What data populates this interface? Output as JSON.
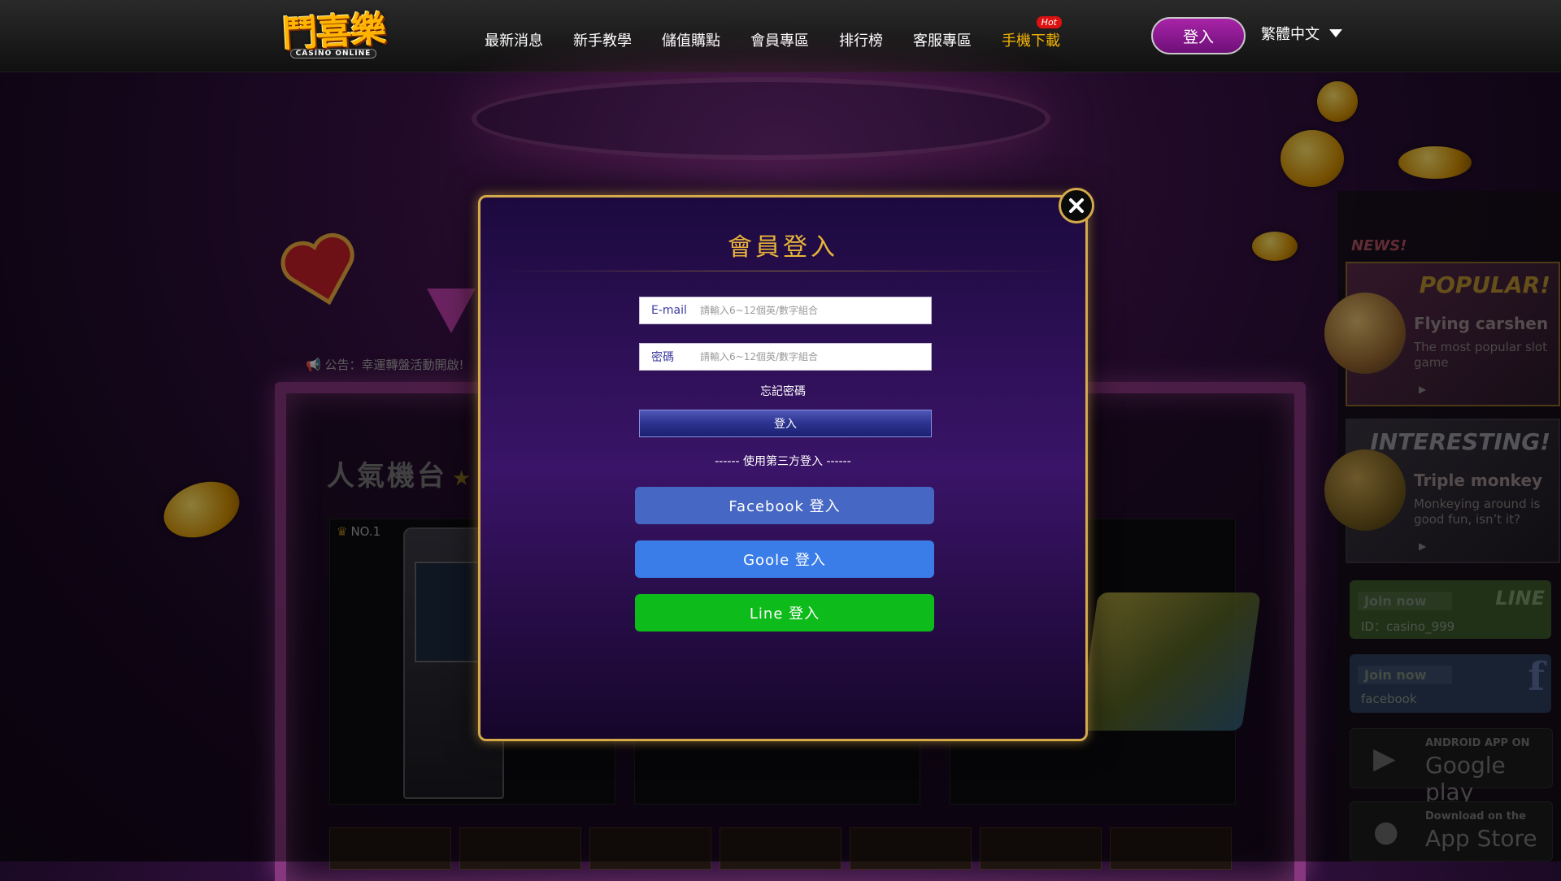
{
  "header": {
    "logo_text": "鬥喜樂",
    "logo_sub": "CASINO ONLINE",
    "nav": [
      {
        "label": "最新消息"
      },
      {
        "label": "新手教學"
      },
      {
        "label": "儲值購點"
      },
      {
        "label": "會員專區"
      },
      {
        "label": "排行榜"
      },
      {
        "label": "客服專區"
      },
      {
        "label": "手機下載",
        "badge": "Hot"
      }
    ],
    "login_label": "登入",
    "language": "繁體中文"
  },
  "background": {
    "notice": "公告：幸運轉盤活動開啟!",
    "section_title": "人氣機台",
    "rank_label": "NO.1",
    "sidebar": {
      "news_label": "NEWS!",
      "promos": [
        {
          "head": "POPULAR!",
          "title": "Flying carshen",
          "desc": "The most popular slot game"
        },
        {
          "head": "INTERESTING!",
          "title": "Triple monkey",
          "desc": "Monkeying around is good fun, isn’t it?"
        }
      ],
      "line": {
        "join": "Join now",
        "id": "ID：casino_999",
        "logo": "LINE"
      },
      "facebook": {
        "join": "Join now",
        "id": "facebook",
        "logo": "f"
      },
      "google_play": {
        "small": "ANDROID APP ON",
        "big": "Google play"
      },
      "app_store": {
        "small": "Download on the",
        "big": "App Store"
      }
    }
  },
  "modal": {
    "title": "會員登入",
    "email_label": "E-mail",
    "email_placeholder": "請輸入6~12個英/數字組合",
    "email_value": "",
    "password_label": "密碼",
    "password_placeholder": "請輸入6~12個英/數字組合",
    "password_value": "",
    "forgot_label": "忘記密碼",
    "submit_label": "登入",
    "third_party_label": "------ 使用第三方登入 ------",
    "facebook_label": "Facebook 登入",
    "google_label": "Goole 登入",
    "line_label": "Line 登入",
    "close_icon": "close-icon"
  },
  "colors": {
    "accent_gold": "#e9b43a",
    "login_purple": "#8e1a96",
    "facebook_blue": "#4668c4",
    "google_blue": "#3b7de8",
    "line_green": "#0dbb1a",
    "hot_red": "#d11111"
  }
}
